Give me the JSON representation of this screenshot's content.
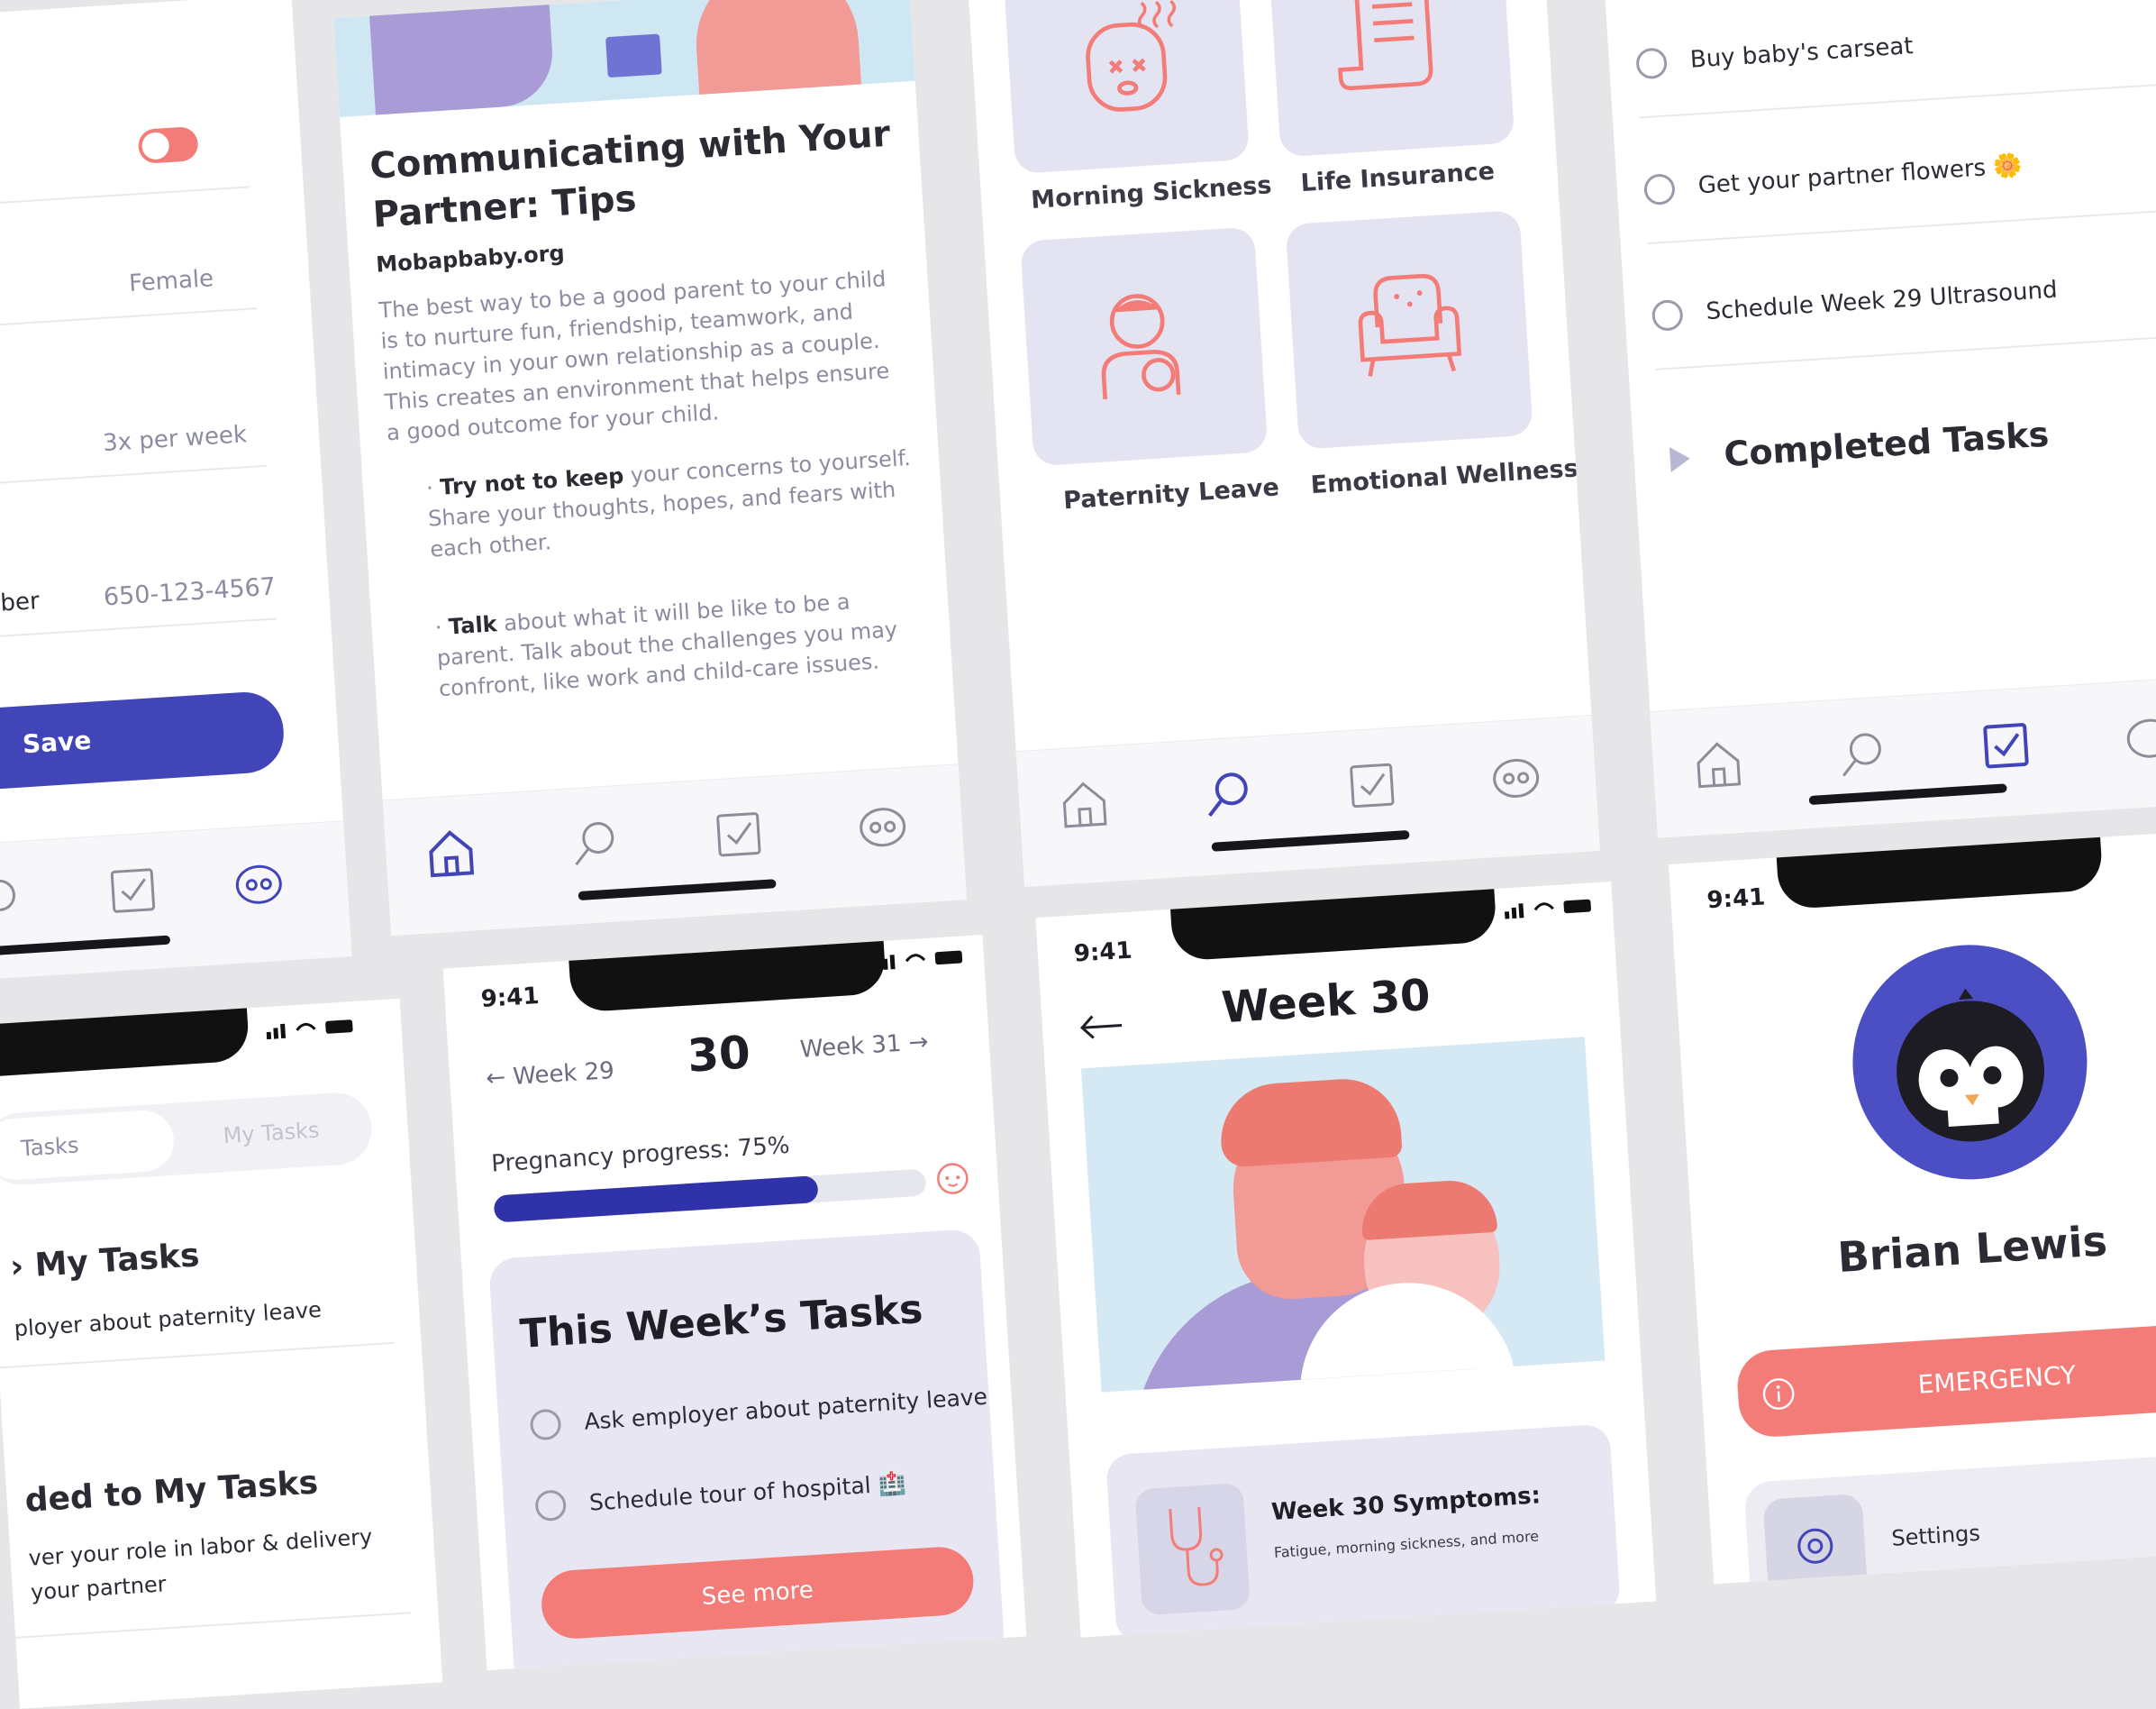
{
  "settings": {
    "gender_value": "Female",
    "frequency_value": "3x per week",
    "phone_label": "mber",
    "phone_value": "650-123-4567",
    "save_label": "Save",
    "toggle_color": "#f47c78"
  },
  "article": {
    "title_line1": "Communicating with Your",
    "title_line2": "Partner: Tips",
    "source": "Mobapbaby.org",
    "para1": [
      "The best way to be a good parent to your child",
      "is to nurture fun, friendship, teamwork, and",
      "intimacy in your own relationship as a couple.",
      "This creates an environment that helps ensure",
      "a good outcome for your child."
    ],
    "bullet1_bold": "Try not to keep",
    "bullet1_rest": " your concerns to yourself.",
    "bullet1_lines": [
      "Share your thoughts, hopes, and fears with",
      "each other."
    ],
    "bullet2_bold": "Talk",
    "bullet2_rest": " about what it will be like to be a",
    "bullet2_lines": [
      "parent. Talk about the challenges you may",
      "confront, like work and child-care issues."
    ]
  },
  "resources": {
    "tiles": [
      {
        "label": "Morning Sickness",
        "icon": "sick-face-icon"
      },
      {
        "label": "Life Insurance",
        "icon": "document-scroll-icon"
      },
      {
        "label": "Paternity Leave",
        "icon": "father-baby-icon"
      },
      {
        "label": "Emotional Wellness",
        "icon": "armchair-icon"
      }
    ]
  },
  "tasks_list": {
    "items": [
      "Buy baby's carseat",
      "Get your partner flowers 🌼",
      "Schedule Week 29 Ultrasound"
    ],
    "completed_heading": "Completed Tasks"
  },
  "status_bar": {
    "time": "9:41"
  },
  "my_tasks": {
    "tab_all": "Tasks",
    "tab_mine": "My Tasks",
    "section1_title": "My Tasks",
    "section1_item": "ployer about paternity leave",
    "section2_title": "ded to My Tasks",
    "section2_line1": "ver your role in labor & delivery",
    "section2_line2": "your partner"
  },
  "week_overview": {
    "prev_week": "Week 29",
    "current_week": "30",
    "next_week": "Week 31",
    "progress_label": "Pregnancy progress: 75%",
    "progress_fraction": 0.75,
    "tasks_title": "This Week’s Tasks",
    "tasks": [
      "Ask employer about paternity leave",
      "Schedule tour of hospital 🏥"
    ],
    "see_more": "See more"
  },
  "week_detail": {
    "title": "Week 30",
    "symptoms_title": "Week 30 Symptoms:",
    "symptoms_text": "Fatigue, morning sickness, and more"
  },
  "profile": {
    "name": "Brian Lewis",
    "emergency_label": "EMERGENCY",
    "settings_label": "Settings",
    "accent": "#4c4fc4",
    "emergency_color": "#f47c78"
  },
  "colors": {
    "primary": "#4245b8",
    "coral": "#f47c78",
    "lavender": "#e4e3f1"
  }
}
